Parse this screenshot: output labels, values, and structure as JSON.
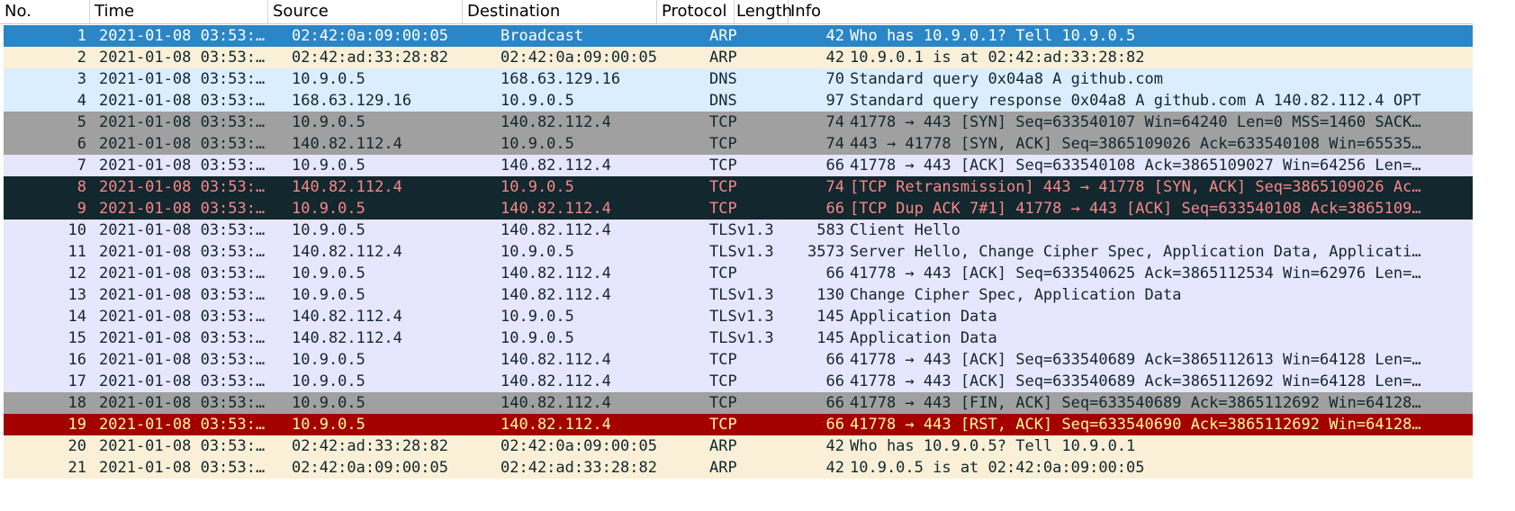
{
  "columns": {
    "no": "No.",
    "time": "Time",
    "source": "Source",
    "destination": "Destination",
    "protocol": "Protocol",
    "length": "Length",
    "info": "Info"
  },
  "packets": [
    {
      "no": "1",
      "time": "2021-01-08 03:53:…",
      "src": "02:42:0a:09:00:05",
      "dst": "Broadcast",
      "proto": "ARP",
      "len": "42",
      "info": "Who has 10.9.0.1? Tell 10.9.0.5",
      "style": "selected"
    },
    {
      "no": "2",
      "time": "2021-01-08 03:53:…",
      "src": "02:42:ad:33:28:82",
      "dst": "02:42:0a:09:00:05",
      "proto": "ARP",
      "len": "42",
      "info": "10.9.0.1 is at 02:42:ad:33:28:82",
      "style": "arp"
    },
    {
      "no": "3",
      "time": "2021-01-08 03:53:…",
      "src": "10.9.0.5",
      "dst": "168.63.129.16",
      "proto": "DNS",
      "len": "70",
      "info": "Standard query 0x04a8 A github.com",
      "style": "dns"
    },
    {
      "no": "4",
      "time": "2021-01-08 03:53:…",
      "src": "168.63.129.16",
      "dst": "10.9.0.5",
      "proto": "DNS",
      "len": "97",
      "info": "Standard query response 0x04a8 A github.com A 140.82.112.4 OPT",
      "style": "dns"
    },
    {
      "no": "5",
      "time": "2021-01-08 03:53:…",
      "src": "10.9.0.5",
      "dst": "140.82.112.4",
      "proto": "TCP",
      "len": "74",
      "info": "41778 → 443 [SYN] Seq=633540107 Win=64240 Len=0 MSS=1460 SACK…",
      "style": "synfin"
    },
    {
      "no": "6",
      "time": "2021-01-08 03:53:…",
      "src": "140.82.112.4",
      "dst": "10.9.0.5",
      "proto": "TCP",
      "len": "74",
      "info": "443 → 41778 [SYN, ACK] Seq=3865109026 Ack=633540108 Win=65535…",
      "style": "synfin"
    },
    {
      "no": "7",
      "time": "2021-01-08 03:53:…",
      "src": "10.9.0.5",
      "dst": "140.82.112.4",
      "proto": "TCP",
      "len": "66",
      "info": "41778 → 443 [ACK] Seq=633540108 Ack=3865109027 Win=64256 Len=…",
      "style": "tcp"
    },
    {
      "no": "8",
      "time": "2021-01-08 03:53:…",
      "src": "140.82.112.4",
      "dst": "10.9.0.5",
      "proto": "TCP",
      "len": "74",
      "info": "[TCP Retransmission] 443 → 41778 [SYN, ACK] Seq=3865109026 Ac…",
      "style": "bad"
    },
    {
      "no": "9",
      "time": "2021-01-08 03:53:…",
      "src": "10.9.0.5",
      "dst": "140.82.112.4",
      "proto": "TCP",
      "len": "66",
      "info": "[TCP Dup ACK 7#1] 41778 → 443 [ACK] Seq=633540108 Ack=3865109…",
      "style": "bad"
    },
    {
      "no": "10",
      "time": "2021-01-08 03:53:…",
      "src": "10.9.0.5",
      "dst": "140.82.112.4",
      "proto": "TLSv1.3",
      "len": "583",
      "info": "Client Hello",
      "style": "tls"
    },
    {
      "no": "11",
      "time": "2021-01-08 03:53:…",
      "src": "140.82.112.4",
      "dst": "10.9.0.5",
      "proto": "TLSv1.3",
      "len": "3573",
      "info": "Server Hello, Change Cipher Spec, Application Data, Applicati…",
      "style": "tls"
    },
    {
      "no": "12",
      "time": "2021-01-08 03:53:…",
      "src": "10.9.0.5",
      "dst": "140.82.112.4",
      "proto": "TCP",
      "len": "66",
      "info": "41778 → 443 [ACK] Seq=633540625 Ack=3865112534 Win=62976 Len=…",
      "style": "tcp"
    },
    {
      "no": "13",
      "time": "2021-01-08 03:53:…",
      "src": "10.9.0.5",
      "dst": "140.82.112.4",
      "proto": "TLSv1.3",
      "len": "130",
      "info": "Change Cipher Spec, Application Data",
      "style": "tls"
    },
    {
      "no": "14",
      "time": "2021-01-08 03:53:…",
      "src": "140.82.112.4",
      "dst": "10.9.0.5",
      "proto": "TLSv1.3",
      "len": "145",
      "info": "Application Data",
      "style": "tls"
    },
    {
      "no": "15",
      "time": "2021-01-08 03:53:…",
      "src": "140.82.112.4",
      "dst": "10.9.0.5",
      "proto": "TLSv1.3",
      "len": "145",
      "info": "Application Data",
      "style": "tls"
    },
    {
      "no": "16",
      "time": "2021-01-08 03:53:…",
      "src": "10.9.0.5",
      "dst": "140.82.112.4",
      "proto": "TCP",
      "len": "66",
      "info": "41778 → 443 [ACK] Seq=633540689 Ack=3865112613 Win=64128 Len=…",
      "style": "tcp"
    },
    {
      "no": "17",
      "time": "2021-01-08 03:53:…",
      "src": "10.9.0.5",
      "dst": "140.82.112.4",
      "proto": "TCP",
      "len": "66",
      "info": "41778 → 443 [ACK] Seq=633540689 Ack=3865112692 Win=64128 Len=…",
      "style": "tcp"
    },
    {
      "no": "18",
      "time": "2021-01-08 03:53:…",
      "src": "10.9.0.5",
      "dst": "140.82.112.4",
      "proto": "TCP",
      "len": "66",
      "info": "41778 → 443 [FIN, ACK] Seq=633540689 Ack=3865112692 Win=64128…",
      "style": "synfin"
    },
    {
      "no": "19",
      "time": "2021-01-08 03:53:…",
      "src": "10.9.0.5",
      "dst": "140.82.112.4",
      "proto": "TCP",
      "len": "66",
      "info": "41778 → 443 [RST, ACK] Seq=633540690 Ack=3865112692 Win=64128…",
      "style": "rst"
    },
    {
      "no": "20",
      "time": "2021-01-08 03:53:…",
      "src": "02:42:ad:33:28:82",
      "dst": "02:42:0a:09:00:05",
      "proto": "ARP",
      "len": "42",
      "info": "Who has 10.9.0.5? Tell 10.9.0.1",
      "style": "arp"
    },
    {
      "no": "21",
      "time": "2021-01-08 03:53:…",
      "src": "02:42:0a:09:00:05",
      "dst": "02:42:ad:33:28:82",
      "proto": "ARP",
      "len": "42",
      "info": "10.9.0.5 is at 02:42:0a:09:00:05",
      "style": "arp"
    }
  ],
  "colors": {
    "selected": "#2a86c6",
    "arp": "#faf0d7",
    "dns": "#daeeff",
    "tcp": "#e7e6ff",
    "synfin": "#a0a0a0",
    "bad_bg": "#12272e",
    "bad_fg": "#f78787",
    "rst_bg": "#a40000",
    "rst_fg": "#fffc9c"
  }
}
